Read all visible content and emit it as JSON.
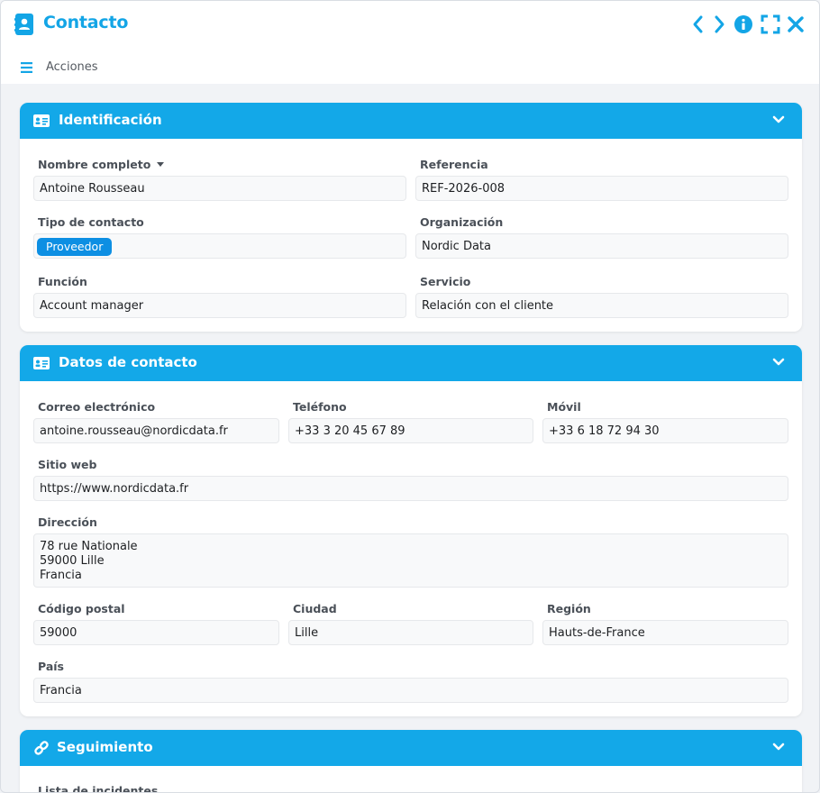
{
  "window": {
    "title": "Contacto",
    "toolbar": {
      "actions_label": "Acciones"
    }
  },
  "colors": {
    "accent": "#13a8e8",
    "badge": "#0d8fe3"
  },
  "identificacion": {
    "title": "Identificación",
    "nombre_label": "Nombre completo",
    "nombre_value": "Antoine Rousseau",
    "referencia_label": "Referencia",
    "referencia_value": "REF-2026-008",
    "tipo_label": "Tipo de contacto",
    "tipo_value": "Proveedor",
    "organizacion_label": "Organización",
    "organizacion_value": "Nordic Data",
    "funcion_label": "Función",
    "funcion_value": "Account manager",
    "servicio_label": "Servicio",
    "servicio_value": "Relación con el cliente"
  },
  "datos": {
    "title": "Datos de contacto",
    "correo_label": "Correo electrónico",
    "correo_value": "antoine.rousseau@nordicdata.fr",
    "telefono_label": "Teléfono",
    "telefono_value": "+33 3 20 45 67 89",
    "movil_label": "Móvil",
    "movil_value": "+33 6 18 72 94 30",
    "web_label": "Sitio web",
    "web_value": "https://www.nordicdata.fr",
    "direccion_label": "Dirección",
    "direccion_value": "78 rue Nationale\n59000 Lille\nFrancia",
    "cp_label": "Código postal",
    "cp_value": "59000",
    "ciudad_label": "Ciudad",
    "ciudad_value": "Lille",
    "region_label": "Región",
    "region_value": "Hauts-de-France",
    "pais_label": "País",
    "pais_value": "Francia"
  },
  "seguimiento": {
    "title": "Seguimiento",
    "incidentes_label": "Lista de incidentes"
  }
}
